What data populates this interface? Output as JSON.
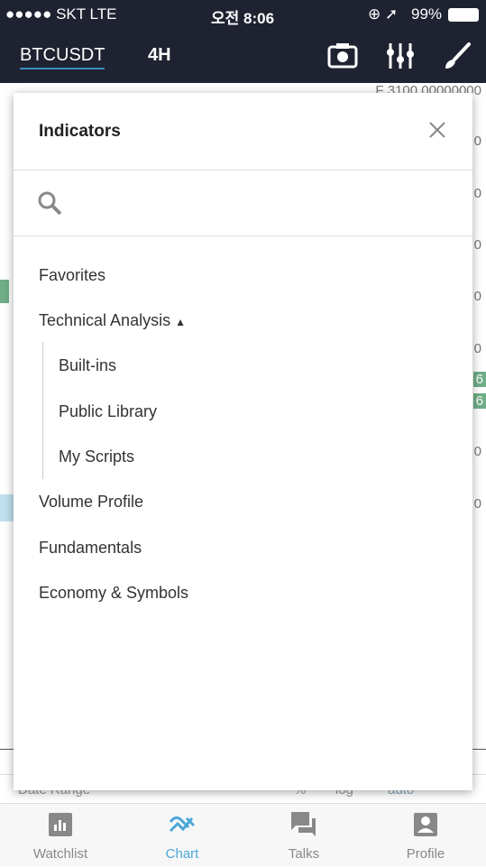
{
  "status": {
    "carrier": "●●●●● SKT  LTE",
    "time": "오전 8:06",
    "battery": "99%"
  },
  "topbar": {
    "symbol": "BTCUSDT",
    "timeframe": "4H",
    "icons": [
      "camera-icon",
      "indicators-sliders-icon",
      "brush-icon"
    ]
  },
  "chart": {
    "price_label": "F 3100.00000000",
    "axis_labels": [
      "0",
      "0",
      "0",
      "0",
      "0",
      "0",
      "6",
      "6",
      "0",
      "0"
    ],
    "bottom": {
      "date_range": "Date Range",
      "percent": "%",
      "log": "log",
      "auto": "auto"
    }
  },
  "modal": {
    "title": "Indicators",
    "search_placeholder": "",
    "items": {
      "favorites": "Favorites",
      "technical": "Technical Analysis",
      "builtins": "Built-ins",
      "public": "Public Library",
      "scripts": "My Scripts",
      "volume": "Volume Profile",
      "fundamentals": "Fundamentals",
      "economy": "Economy & Symbols"
    }
  },
  "tabs": [
    {
      "label": "Watchlist"
    },
    {
      "label": "Chart"
    },
    {
      "label": "Talks"
    },
    {
      "label": "Profile"
    }
  ],
  "colors": {
    "header": "#1f2230",
    "accent": "#4aa8d8",
    "green_badge": "#6fae87"
  }
}
